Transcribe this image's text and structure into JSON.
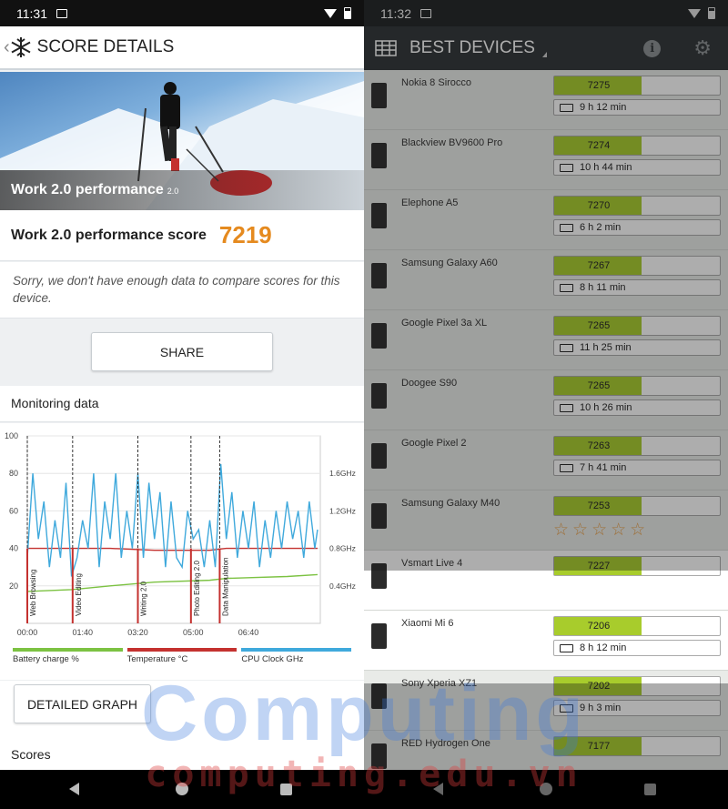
{
  "left": {
    "status_time": "11:31",
    "title": "SCORE DETAILS",
    "hero_label": "Work 2.0 performance",
    "hero_version": "2.0",
    "score_label": "Work 2.0 performance score",
    "score_value": "7219",
    "sorry_text": "Sorry, we don't have enough data to compare scores for this device.",
    "share_label": "SHARE",
    "monitoring_title": "Monitoring data",
    "detailed_label": "DETAILED GRAPH",
    "scores_title": "Scores",
    "legend": [
      {
        "label": "Battery charge %",
        "color": "#7cc242"
      },
      {
        "label": "Temperature °C",
        "color": "#c4312f"
      },
      {
        "label": "CPU Clock GHz",
        "color": "#3fa9dc"
      }
    ]
  },
  "chart_data": {
    "type": "line",
    "y_left_ticks": [
      "100",
      "80",
      "60",
      "40",
      "20"
    ],
    "y_right_ticks": [
      "1.6GHz",
      "1.2GHz",
      "0.8GHz",
      "0.4GHz"
    ],
    "x_ticks": [
      "00:00",
      "01:40",
      "03:20",
      "05:00",
      "06:40"
    ],
    "markers": [
      {
        "label": "Web Browsing",
        "t": 0
      },
      {
        "label": "Video Editing",
        "t": 82
      },
      {
        "label": "Writing 2.0",
        "t": 200
      },
      {
        "label": "Photo Editing 2.0",
        "t": 296
      },
      {
        "label": "Data Manipulation",
        "t": 348
      }
    ],
    "xlim": [
      0,
      530
    ],
    "ylim": [
      0,
      100
    ],
    "series": [
      {
        "name": "Battery charge %",
        "color": "#7cc242",
        "x": [
          0,
          80,
          150,
          230,
          330,
          360,
          470,
          525
        ],
        "y": [
          17,
          18,
          20,
          22,
          23,
          24,
          25,
          26
        ]
      },
      {
        "name": "Temperature °C",
        "color": "#c4312f",
        "x": [
          0,
          80,
          150,
          230,
          330,
          360,
          470,
          525
        ],
        "y": [
          40,
          40,
          40,
          39,
          39,
          40,
          40,
          40
        ]
      },
      {
        "name": "CPU Clock GHz",
        "color": "#3fa9dc",
        "x": [
          0,
          10,
          20,
          30,
          40,
          50,
          60,
          70,
          80,
          90,
          100,
          110,
          120,
          130,
          140,
          150,
          160,
          170,
          180,
          190,
          200,
          210,
          220,
          230,
          240,
          250,
          260,
          270,
          280,
          290,
          300,
          310,
          320,
          330,
          340,
          350,
          360,
          370,
          380,
          390,
          400,
          410,
          420,
          430,
          440,
          450,
          460,
          470,
          480,
          490,
          500,
          510,
          520,
          525
        ],
        "y": [
          0.7,
          1.6,
          0.9,
          1.3,
          0.6,
          1.1,
          0.7,
          1.5,
          0.5,
          0.7,
          1.1,
          0.8,
          1.6,
          0.6,
          1.3,
          0.9,
          1.6,
          0.7,
          1.2,
          0.8,
          1.6,
          0.7,
          1.5,
          0.9,
          1.4,
          0.6,
          1.3,
          0.7,
          0.6,
          1.2,
          0.9,
          1.0,
          0.6,
          1.1,
          0.6,
          1.7,
          0.9,
          1.4,
          0.7,
          1.2,
          0.8,
          1.3,
          0.6,
          1.1,
          0.7,
          1.2,
          0.8,
          1.3,
          0.9,
          1.2,
          0.7,
          1.3,
          0.8,
          1.0
        ]
      }
    ]
  },
  "right": {
    "status_time": "11:32",
    "title": "BEST DEVICES",
    "devices": [
      {
        "name": "Nokia 8 Sirocco",
        "score": "7275",
        "battery": "9 h 12 min",
        "pct": 0.53
      },
      {
        "name": "Blackview BV9600 Pro",
        "score": "7274",
        "battery": "10 h 44 min",
        "pct": 0.53
      },
      {
        "name": "Elephone A5",
        "score": "7270",
        "battery": "6 h 2 min",
        "pct": 0.53
      },
      {
        "name": "Samsung Galaxy A60",
        "score": "7267",
        "battery": "8 h 11 min",
        "pct": 0.53
      },
      {
        "name": "Google Pixel 3a XL",
        "score": "7265",
        "battery": "11 h 25 min",
        "pct": 0.53
      },
      {
        "name": "Doogee S90",
        "score": "7265",
        "battery": "10 h 26 min",
        "pct": 0.53
      },
      {
        "name": "Google Pixel 2",
        "score": "7263",
        "battery": "7 h 41 min",
        "pct": 0.53
      },
      {
        "name": "Samsung Galaxy M40",
        "score": "7253",
        "battery": "",
        "pct": 0.53,
        "stars": "☆☆☆☆☆"
      },
      {
        "name": "Vsmart Live 4",
        "score": "7227",
        "battery": "",
        "pct": 0.53
      },
      {
        "name": "Xiaomi Mi 6",
        "score": "7206",
        "battery": "8 h 12 min",
        "pct": 0.53
      },
      {
        "name": "Sony Xperia XZ1",
        "score": "7202",
        "battery": "9 h 3 min",
        "pct": 0.53
      },
      {
        "name": "RED Hydrogen One",
        "score": "7177",
        "battery": "",
        "pct": 0.53
      }
    ]
  },
  "watermark": {
    "main": "Computing",
    "sub": "computing.edu.vn"
  }
}
